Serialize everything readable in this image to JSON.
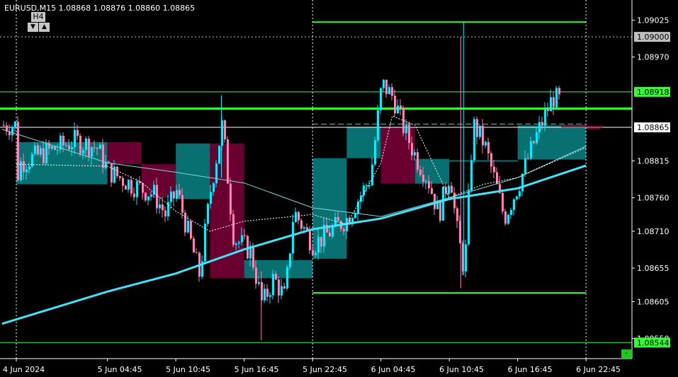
{
  "header": {
    "symbol_info": "EURUSD,M15  1.08868 1.08876 1.08860 1.08865",
    "timeframe_label": "H4",
    "tf_down_icon": "▼",
    "tf_up_icon": "▲"
  },
  "corner_button_label": "-",
  "colors": {
    "background": "#000000",
    "axis": "#ffffff",
    "bull_candle": "#00f0ff",
    "bear_candle": "#ff82b4",
    "htf_bull_box": "#087070",
    "htf_bear_box": "#6a0030",
    "green_line": "#32ff32",
    "ma_slow": "#3fe4f6",
    "ma_fast": "#7fd6df",
    "grid_dashed": "#c8c8c8"
  },
  "chart_data": {
    "type": "candlestick",
    "symbol": "EURUSD",
    "timeframe": "M15",
    "ylim": [
      1.0852,
      1.09055
    ],
    "y_ticks": [
      "1.09025",
      "1.08970",
      "1.08815",
      "1.08760",
      "1.08710",
      "1.08655",
      "1.08605",
      "1.08550"
    ],
    "x_tick_labels": [
      "4 Jun 2024",
      "5 Jun 04:45",
      "5 Jun 10:45",
      "5 Jun 16:45",
      "5 Jun 22:45",
      "6 Jun 04:45",
      "6 Jun 10:45",
      "6 Jun 16:45",
      "6 Jun 22:45"
    ],
    "price_labels": [
      {
        "label": "1.09000",
        "value": 1.09,
        "bg": "#c0c0c0",
        "fg": "#000000"
      },
      {
        "label": "1.08918",
        "value": 1.08918,
        "bg": "#32ff32",
        "fg": "#000000"
      },
      {
        "label": "1.08865",
        "value": 1.08865,
        "bg": "#ffffff",
        "fg": "#000000"
      },
      {
        "label": "1.08544",
        "value": 1.08544,
        "bg": "#32ff32",
        "fg": "#000000"
      }
    ],
    "horizontal_lines": [
      {
        "value": 1.09,
        "style": "dotted",
        "color": "#c0c0c0",
        "from": "start",
        "width": 1
      },
      {
        "value": 1.08918,
        "style": "solid",
        "color": "#32ff32",
        "from": "start",
        "width": 1
      },
      {
        "value": 1.08893,
        "style": "solid",
        "color": "#32ff32",
        "from": "start",
        "to": "5 Jun 10:45",
        "width": 3
      },
      {
        "value": 1.08865,
        "style": "solid",
        "color": "#ffffff",
        "from": "start",
        "width": 1
      },
      {
        "value": 1.08544,
        "style": "solid",
        "color": "#32ff32",
        "from": "start",
        "width": 1
      },
      {
        "value": 1.09022,
        "style": "solid",
        "color": "#32ff32",
        "from": "5 Jun 22:45",
        "to": "6 Jun 22:45",
        "width": 2
      },
      {
        "value": 1.08893,
        "style": "solid",
        "color": "#32ff32",
        "from": "5 Jun 22:45",
        "to": "6 Jun 22:45",
        "width": 3
      },
      {
        "value": 1.0887,
        "style": "dashed",
        "color": "#32ff32",
        "from": "5 Jun 22:45",
        "to": "6 Jun 22:45",
        "width": 1
      },
      {
        "value": 1.08618,
        "style": "solid",
        "color": "#32ff32",
        "from": "5 Jun 22:45",
        "to": "6 Jun 22:45",
        "width": 2
      }
    ],
    "vertical_lines_at": [
      "4 Jun 2024",
      "5 Jun 22:45",
      "6 Jun 22:45"
    ],
    "htf_boxes": [
      {
        "from": "4 Jun 2024",
        "to": "5 Jun 04:45",
        "open": 1.0878,
        "close": 1.08843,
        "dir": "bull"
      },
      {
        "from": "5 Jun 04:45",
        "to": "5 Jun 07:45",
        "open": 1.08843,
        "close": 1.0881,
        "dir": "bear"
      },
      {
        "from": "5 Jun 07:45",
        "to": "5 Jun 10:45",
        "open": 1.0881,
        "close": 1.0876,
        "dir": "bear"
      },
      {
        "from": "5 Jun 10:45",
        "to": "5 Jun 13:45",
        "open": 1.08758,
        "close": 1.08841,
        "dir": "bull"
      },
      {
        "from": "5 Jun 13:45",
        "to": "5 Jun 16:45",
        "open": 1.08841,
        "close": 1.0864,
        "dir": "bear"
      },
      {
        "from": "5 Jun 16:45",
        "to": "5 Jun 22:45",
        "open": 1.0864,
        "close": 1.08667,
        "dir": "bull"
      },
      {
        "from": "5 Jun 22:45",
        "to": "6 Jun 01:45",
        "open": 1.08669,
        "close": 1.08819,
        "dir": "bull"
      },
      {
        "from": "6 Jun 01:45",
        "to": "6 Jun 04:45",
        "open": 1.08819,
        "close": 1.08866,
        "dir": "bull"
      },
      {
        "from": "6 Jun 04:45",
        "to": "6 Jun 07:45",
        "open": 1.08866,
        "close": 1.08781,
        "dir": "bear"
      },
      {
        "from": "6 Jun 07:45",
        "to": "6 Jun 10:45",
        "open": 1.08781,
        "close": 1.08818,
        "dir": "bull"
      },
      {
        "from": "6 Jun 10:45",
        "to": "6 Jun 16:45",
        "open": 1.08816,
        "close": 1.08816,
        "dir": "bull"
      },
      {
        "from": "6 Jun 16:45",
        "to": "6 Jun 22:45",
        "open": 1.08817,
        "close": 1.08868,
        "dir": "bull"
      },
      {
        "from": "6 Jun 22:45",
        "to": "6 Jun 24:00",
        "open": 1.08866,
        "close": 1.08862,
        "dir": "bear"
      }
    ],
    "ma_slow_anchors": [
      {
        "t": "4 Jun 2024",
        "v": 1.08572
      },
      {
        "t": "5 Jun 04:45",
        "v": 1.0862
      },
      {
        "t": "5 Jun 10:45",
        "v": 1.08647
      },
      {
        "t": "5 Jun 16:45",
        "v": 1.08683
      },
      {
        "t": "5 Jun 22:45",
        "v": 1.08713
      },
      {
        "t": "6 Jun 04:45",
        "v": 1.08729
      },
      {
        "t": "6 Jun 10:45",
        "v": 1.08758
      },
      {
        "t": "6 Jun 16:45",
        "v": 1.08774
      },
      {
        "t": "6 Jun 22:45",
        "v": 1.08808
      }
    ],
    "ma_fast_anchors": [
      {
        "t": "4 Jun 2024",
        "v": 1.08862
      },
      {
        "t": "5 Jun 04:45",
        "v": 1.08812
      },
      {
        "t": "5 Jun 10:45",
        "v": 1.08798
      },
      {
        "t": "5 Jun 16:45",
        "v": 1.08782
      },
      {
        "t": "5 Jun 22:45",
        "v": 1.08745
      },
      {
        "t": "6 Jun 04:45",
        "v": 1.08732
      },
      {
        "t": "6 Jun 10:45",
        "v": 1.0876
      },
      {
        "t": "6 Jun 16:45",
        "v": 1.0879
      },
      {
        "t": "6 Jun 22:45",
        "v": 1.08837
      }
    ],
    "ma_dashed_anchors": [
      {
        "t": "4 Jun 2024",
        "v": 1.0881
      },
      {
        "t": "5 Jun 04:45",
        "v": 1.08807
      },
      {
        "t": "5 Jun 07:45",
        "v": 1.08783
      },
      {
        "t": "5 Jun 10:45",
        "v": 1.0874
      },
      {
        "t": "5 Jun 13:45",
        "v": 1.0871
      },
      {
        "t": "5 Jun 16:45",
        "v": 1.08725
      },
      {
        "t": "5 Jun 22:45",
        "v": 1.08735
      },
      {
        "t": "6 Jun 01:45",
        "v": 1.0872
      },
      {
        "t": "6 Jun 04:45",
        "v": 1.08812
      },
      {
        "t": "6 Jun 05:45",
        "v": 1.08882
      },
      {
        "t": "6 Jun 07:45",
        "v": 1.08868
      },
      {
        "t": "6 Jun 10:45",
        "v": 1.0876
      },
      {
        "t": "6 Jun 13:45",
        "v": 1.0878
      },
      {
        "t": "6 Jun 16:45",
        "v": 1.0879
      },
      {
        "t": "6 Jun 22:45",
        "v": 1.08835
      }
    ],
    "candles_close_path": [
      {
        "t": "4 Jun 2024",
        "v": 1.0879
      },
      {
        "t": "4 Jun 21:00",
        "v": 1.08812
      },
      {
        "t": "5 Jun 01:45",
        "v": 1.08845
      },
      {
        "t": "5 Jun 03:45",
        "v": 1.08835
      },
      {
        "t": "5 Jun 04:45",
        "v": 1.088
      },
      {
        "t": "5 Jun 06:45",
        "v": 1.0878
      },
      {
        "t": "5 Jun 08:45",
        "v": 1.08765
      },
      {
        "t": "5 Jun 09:45",
        "v": 1.08735
      },
      {
        "t": "5 Jun 10:45",
        "v": 1.0877
      },
      {
        "t": "5 Jun 12:45",
        "v": 1.08645
      },
      {
        "t": "5 Jun 13:45",
        "v": 1.08775
      },
      {
        "t": "5 Jun 14:45",
        "v": 1.0887
      },
      {
        "t": "5 Jun 15:45",
        "v": 1.087
      },
      {
        "t": "5 Jun 17:15",
        "v": 1.0868
      },
      {
        "t": "5 Jun 18:15",
        "v": 1.086
      },
      {
        "t": "5 Jun 19:15",
        "v": 1.0864
      },
      {
        "t": "5 Jun 20:15",
        "v": 1.0861
      },
      {
        "t": "5 Jun 21:00",
        "v": 1.0874
      },
      {
        "t": "5 Jun 22:45",
        "v": 1.0869
      },
      {
        "t": "6 Jun 01:45",
        "v": 1.0873
      },
      {
        "t": "6 Jun 03:45",
        "v": 1.0879
      },
      {
        "t": "6 Jun 04:45",
        "v": 1.0893
      },
      {
        "t": "6 Jun 05:45",
        "v": 1.0891
      },
      {
        "t": "6 Jun 06:45",
        "v": 1.0886
      },
      {
        "t": "6 Jun 07:45",
        "v": 1.0882
      },
      {
        "t": "6 Jun 08:45",
        "v": 1.0879
      },
      {
        "t": "6 Jun 09:45",
        "v": 1.08735
      },
      {
        "t": "6 Jun 10:45",
        "v": 1.088
      },
      {
        "t": "6 Jun 11:15",
        "v": 1.0872
      },
      {
        "t": "6 Jun 12:00",
        "v": 1.0865
      },
      {
        "t": "6 Jun 12:45",
        "v": 1.0887
      },
      {
        "t": "6 Jun 13:45",
        "v": 1.0884
      },
      {
        "t": "6 Jun 14:45",
        "v": 1.0878
      },
      {
        "t": "6 Jun 15:30",
        "v": 1.0873
      },
      {
        "t": "6 Jun 16:45",
        "v": 1.0878
      },
      {
        "t": "6 Jun 18:15",
        "v": 1.0885
      },
      {
        "t": "6 Jun 19:45",
        "v": 1.0891
      },
      {
        "t": "6 Jun 20:45",
        "v": 1.089
      },
      {
        "t": "6 Jun 22:45",
        "v": 1.08868
      }
    ],
    "spikes": [
      {
        "t": "5 Jun 14:45",
        "high": 1.08913,
        "low": 1.0879
      },
      {
        "t": "5 Jun 18:15",
        "high": 1.0865,
        "low": 1.08547
      },
      {
        "t": "6 Jun 12:00",
        "high": 1.09022,
        "low": 1.08645
      },
      {
        "t": "6 Jun 11:45",
        "high": 1.09,
        "low": 1.08625
      }
    ],
    "grid": false
  }
}
